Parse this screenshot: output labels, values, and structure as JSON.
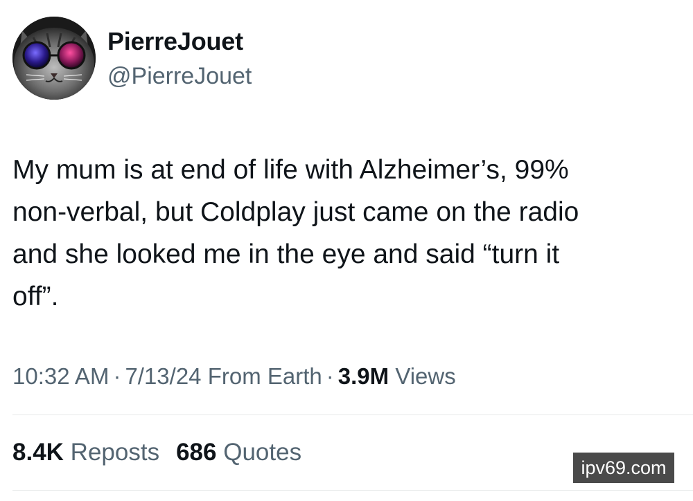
{
  "author": {
    "display_name": "PierreJouet",
    "handle": "@PierreJouet",
    "avatar_icon": "cat-with-sunglasses-avatar"
  },
  "tweet": {
    "text_lines": [
      "My mum is at end of life with Alzheimer’s, 99%",
      "non-verbal, but Coldplay just came on the radio",
      "and she looked me in the eye and said “turn it",
      "off”."
    ],
    "time": "10:32 AM",
    "date": "7/13/24",
    "source": "From Earth",
    "separator": "·",
    "views_count": "3.9M",
    "views_label": "Views"
  },
  "stats": {
    "reposts_count": "8.4K",
    "reposts_label": "Reposts",
    "quotes_count": "686",
    "quotes_label": "Quotes"
  },
  "watermark": {
    "text": "ipv69.com"
  },
  "colors": {
    "text_primary": "#0f1419",
    "text_secondary": "#536471",
    "divider": "#e7e9ea",
    "watermark_bg": "#4a4a4a"
  }
}
